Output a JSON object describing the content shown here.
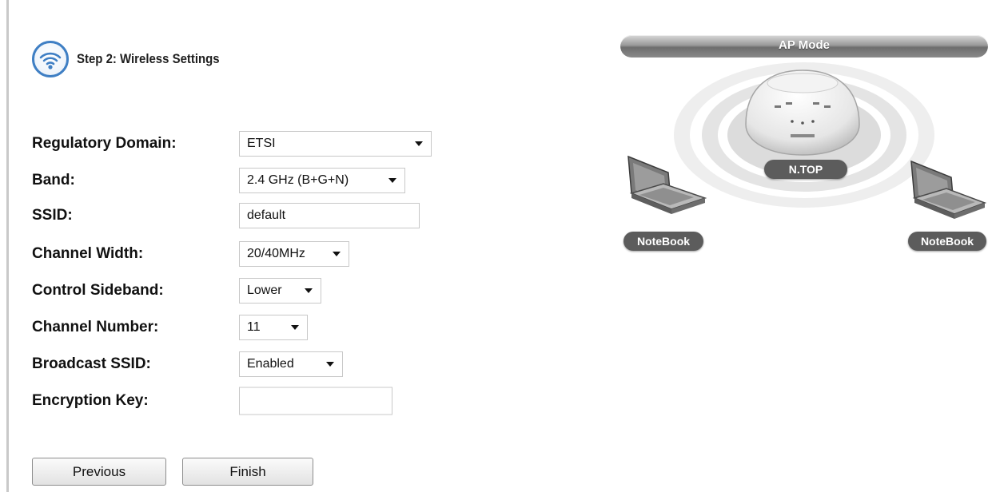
{
  "step": {
    "title": "Step 2: Wireless Settings",
    "icon": "wifi-icon"
  },
  "form": {
    "regulatory_domain": {
      "label": "Regulatory Domain:",
      "value": "ETSI"
    },
    "band": {
      "label": "Band:",
      "value": "2.4 GHz (B+G+N)"
    },
    "ssid": {
      "label": "SSID:",
      "value": "default"
    },
    "channel_width": {
      "label": "Channel Width:",
      "value": "20/40MHz"
    },
    "control_sideband": {
      "label": "Control Sideband:",
      "value": "Lower"
    },
    "channel_number": {
      "label": "Channel Number:",
      "value": "11"
    },
    "broadcast_ssid": {
      "label": "Broadcast SSID:",
      "value": "Enabled"
    },
    "encryption_key": {
      "label": "Encryption Key:",
      "value": ""
    }
  },
  "buttons": {
    "previous": "Previous",
    "finish": "Finish"
  },
  "diagram": {
    "mode": "AP Mode",
    "access_point": "N.TOP",
    "client_left": "NoteBook",
    "client_right": "NoteBook"
  }
}
